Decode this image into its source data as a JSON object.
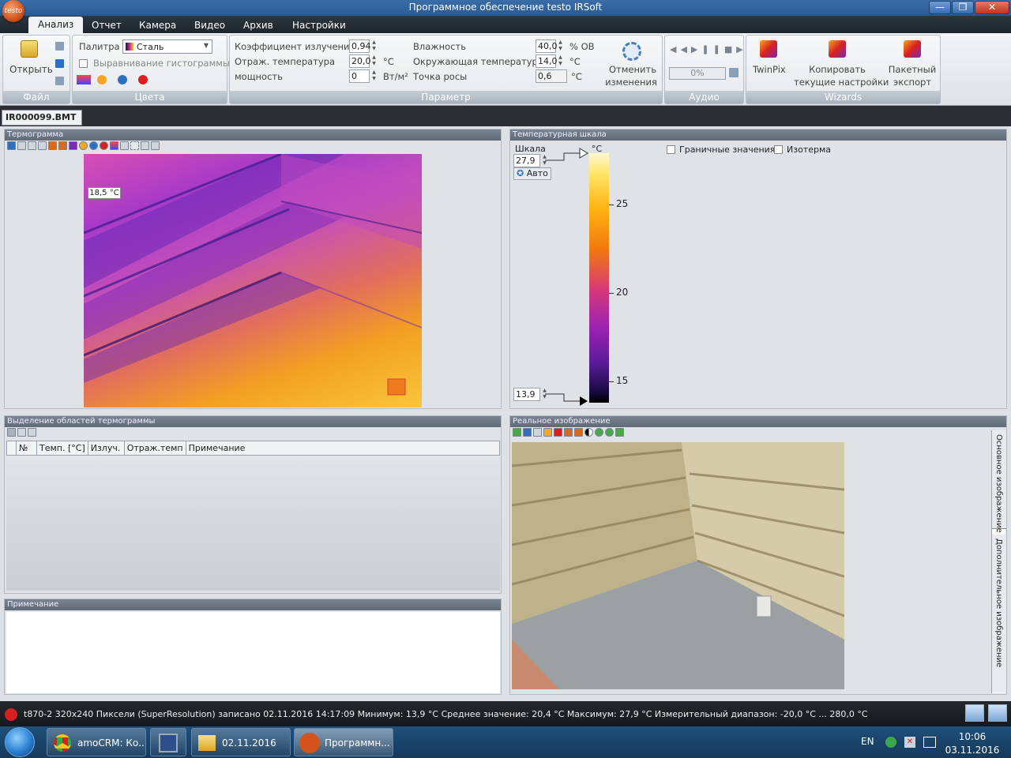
{
  "window": {
    "title": "Программное обеспечение testo IRSoft",
    "logo_text": "testo",
    "min": "—",
    "max": "❐",
    "close": "✕"
  },
  "menu": [
    "Анализ",
    "Отчет",
    "Камера",
    "Видео",
    "Архив",
    "Настройки"
  ],
  "ribbon": {
    "file": {
      "open": "Открыть",
      "label": "Файл"
    },
    "colors": {
      "palette_label": "Палитра",
      "palette_value": "Сталь",
      "histogram": "Выравнивание гистограммы",
      "label": "Цвета"
    },
    "params": {
      "emissivity_label": "Коэффициент излучения",
      "emissivity": "0,94",
      "refl_label": "Отраж. температура",
      "refl": "20,0",
      "refl_unit": "°C",
      "power_label": "мощность",
      "power": "0",
      "power_unit": "Вт/м²",
      "humidity_label": "Влажность",
      "humidity": "40,0",
      "humidity_unit": "% ОВ",
      "ambient_label": "Окружающая температура",
      "ambient": "14,0",
      "ambient_unit": "°C",
      "dew_label": "Точка росы",
      "dew": "0,6",
      "dew_unit": "°C",
      "undo_line1": "Отменить",
      "undo_line2": "изменения",
      "label": "Параметр"
    },
    "audio": {
      "progress": "0%",
      "label": "Аудио"
    },
    "wizards": {
      "twinpix": "TwinPix",
      "copy_line1": "Копировать",
      "copy_line2": "текущие настройки",
      "batch_line1": "Пакетный",
      "batch_line2": "экспорт",
      "label": "Wizards"
    }
  },
  "doc_tab": {
    "name": "IR000099.BMT",
    "close": "×"
  },
  "thermogram": {
    "title": "Термограмма",
    "spot_label": "18,5 °C"
  },
  "scale": {
    "title": "Температурная шкала",
    "scale_label": "Шкала",
    "max_value": "27,9",
    "auto": "Авто",
    "min_value": "13,9",
    "unit": "°C",
    "ticks": [
      "25",
      "20",
      "15"
    ],
    "limits": "Граничные значения",
    "isotherm": "Изотерма"
  },
  "regions": {
    "title": "Выделение областей термограммы",
    "columns": [
      "№",
      "Темп. [°C]",
      "Излуч.",
      "Отраж.темп",
      "Примечание"
    ]
  },
  "note": {
    "title": "Примечание"
  },
  "real": {
    "title": "Реальное изображение",
    "side_tab1": "Основное изображение",
    "side_tab2": "Дополнительное изображение"
  },
  "status": {
    "text": "t870-2  320x240  Пиксели  (SuperResolution)  записано  02.11.2016  14:17:09  Минимум:  13,9 °C  Среднее значение:  20,4 °C  Максимум:  27,9 °C  Измерительный диапазон:  -20,0 °C ... 280,0 °C"
  },
  "taskbar": {
    "items": [
      "amoCRM: Ко...",
      "",
      "02.11.2016",
      "Программн..."
    ],
    "lang": "EN",
    "time": "10:06",
    "date": "03.11.2016"
  },
  "colors": {
    "titlebar": "#2a5a94",
    "accent": "#d4531c"
  }
}
